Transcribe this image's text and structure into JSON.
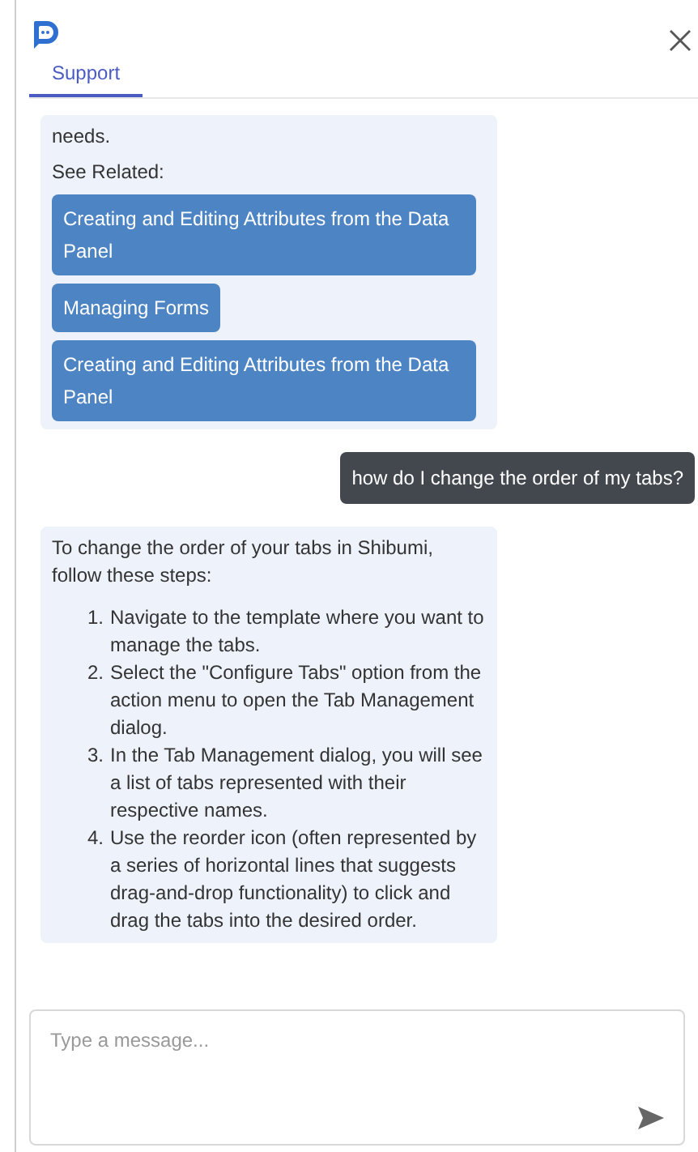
{
  "tabs": [
    {
      "label": "Support",
      "selected": true
    }
  ],
  "messages": [
    {
      "kind": "bot",
      "paragraphs": [
        "needs.",
        "See Related:"
      ],
      "links": [
        "Creating and Editing Attributes from the Data Panel",
        "Managing Forms",
        "Creating and Editing Attributes from the Data Panel"
      ]
    },
    {
      "kind": "user",
      "text": "how do I change the order of my tabs?"
    },
    {
      "kind": "bot",
      "paragraphs": [
        "To change the order of your tabs in Shibumi, follow these steps:"
      ],
      "steps": [
        {
          "number": "1.",
          "text": "Navigate to the template where you want to manage the tabs."
        },
        {
          "number": "2.",
          "text": "Select the \"Configure Tabs\" option from the action menu to open the Tab Management dialog."
        },
        {
          "number": "3.",
          "text": "In the Tab Management dialog, you will see a list of tabs represented with their respective names."
        },
        {
          "number": "4.",
          "text": "Use the reorder icon (often represented by a series of horizontal lines that suggests drag-and-drop functionality) to click and drag the tabs into the desired order."
        }
      ]
    }
  ],
  "composer": {
    "placeholder": "Type a message..."
  }
}
